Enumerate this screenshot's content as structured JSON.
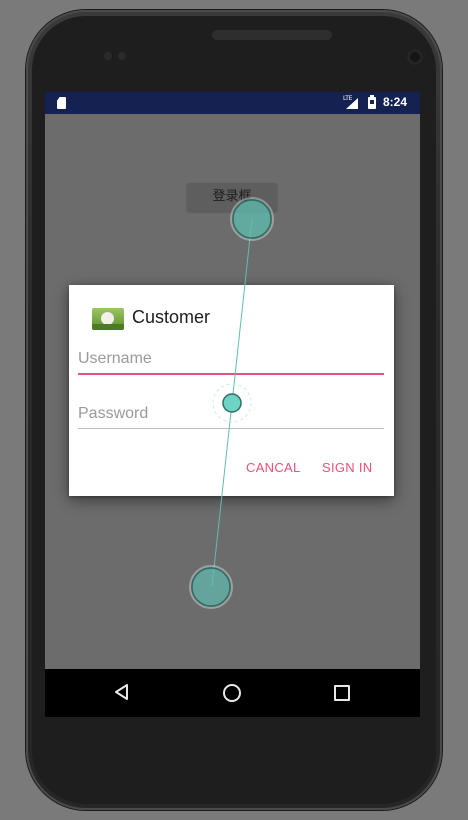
{
  "status_bar": {
    "network": "LTE",
    "time": "8:24"
  },
  "background_button": {
    "label": "登录框"
  },
  "dialog": {
    "title": "Customer",
    "icon": "dog-photo-icon",
    "username_placeholder": "Username",
    "password_placeholder": "Password",
    "cancel_label": "CANCAL",
    "signin_label": "SIGN IN"
  },
  "nav_bar": {
    "back_icon": "triangle-back-icon",
    "home_icon": "circle-home-icon",
    "recent_icon": "square-recents-icon"
  },
  "colors": {
    "accent": "#e9507b",
    "status_bar": "#142151",
    "touch": "#5fbeb0"
  }
}
